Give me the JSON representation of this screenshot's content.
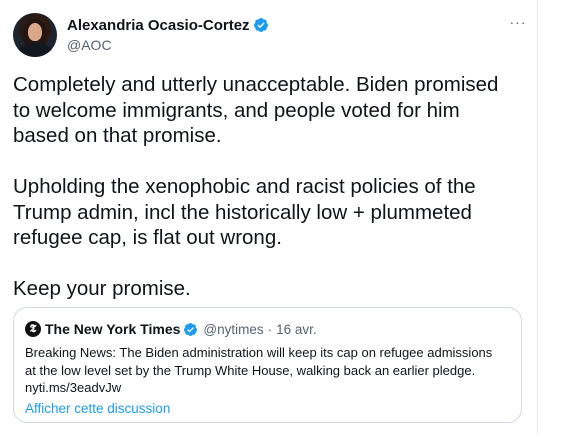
{
  "author": {
    "display_name": "Alexandria Ocasio-Cortez",
    "handle": "@AOC",
    "verified": true
  },
  "tweet": {
    "text": "Completely and utterly unacceptable. Biden promised\nto welcome immigrants, and people voted for him\nbased on that promise.\n\nUpholding the xenophobic and racist policies of the\nTrump admin, incl the historically low + plummeted\nrefugee cap, is flat out wrong.\n\nKeep your promise."
  },
  "more_menu": {
    "label": "···"
  },
  "quoted_tweet": {
    "logo_glyph": "𝕿",
    "display_name": "The New York Times",
    "handle": "@nytimes",
    "separator": "·",
    "date": "16 avr.",
    "text": "Breaking News: The Biden administration will keep its cap on refugee admissions\nat the low level set by the Trump White House, walking back an earlier pledge.\nnyti.ms/3eadvJw",
    "show_thread_label": "Afficher cette discussion"
  },
  "colors": {
    "verified_badge": "#1d9bf0",
    "link": "#1d9bf0",
    "secondary_text": "#536471",
    "border": "#cfd9de"
  },
  "icons": {
    "verified": "verified-badge-icon",
    "more": "more-horizontal-icon",
    "quoted_logo": "nyt-logo-icon"
  }
}
